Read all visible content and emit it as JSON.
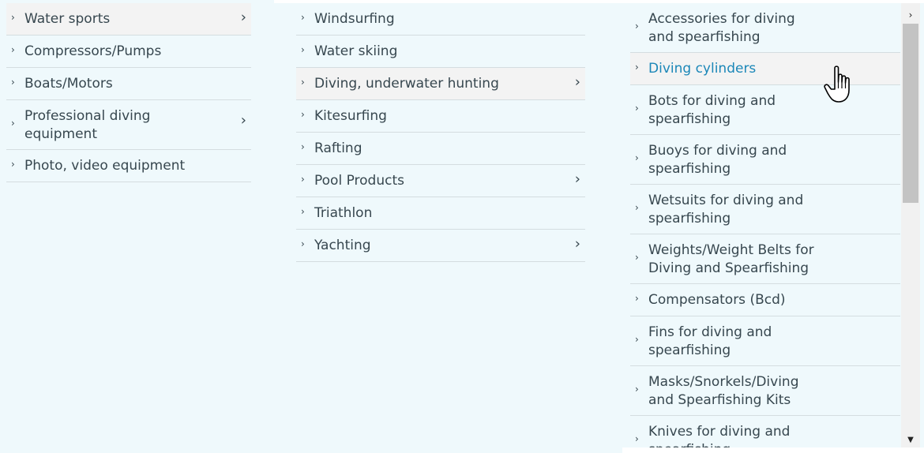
{
  "column1": {
    "items": [
      {
        "label": "Water sports",
        "has_children": true,
        "active": true
      },
      {
        "label": "Compressors/Pumps",
        "has_children": false
      },
      {
        "label": "Boats/Motors",
        "has_children": false
      },
      {
        "label": "Professional diving equipment",
        "has_children": true
      },
      {
        "label": "Photo, video equipment",
        "has_children": false
      }
    ]
  },
  "column2": {
    "items": [
      {
        "label": "Windsurfing",
        "has_children": false
      },
      {
        "label": "Water skiing",
        "has_children": false
      },
      {
        "label": "Diving, underwater hunting",
        "has_children": true,
        "active": true
      },
      {
        "label": "Kitesurfing",
        "has_children": false
      },
      {
        "label": "Rafting",
        "has_children": false
      },
      {
        "label": "Pool Products",
        "has_children": true
      },
      {
        "label": "Triathlon",
        "has_children": false
      },
      {
        "label": "Yachting",
        "has_children": true
      }
    ]
  },
  "column3": {
    "items": [
      {
        "label": "Accessories for diving and spearfishing"
      },
      {
        "label": "Diving cylinders",
        "hovered": true
      },
      {
        "label": "Bots for diving and spearfishing"
      },
      {
        "label": "Buoys for diving and spearfishing"
      },
      {
        "label": "Wetsuits for diving and spearfishing"
      },
      {
        "label": "Weights/Weight Belts for Diving and Spearfishing"
      },
      {
        "label": "Compensators (Bcd)"
      },
      {
        "label": "Fins for diving and spearfishing"
      },
      {
        "label": "Masks/Snorkels/Diving and Spearfishing Kits"
      },
      {
        "label": "Knives for diving and spearfishing"
      }
    ]
  },
  "icons": {
    "bullet": "chevron-right-small-icon",
    "expand": "chevron-right-icon",
    "scroll_up": "scroll-up-arrow-icon",
    "scroll_down": "scroll-down-arrow-icon",
    "pointer": "hand-pointer-icon"
  },
  "colors": {
    "panel_bg": "#eff9fc",
    "text": "#37474f",
    "hover_text": "#1b87b8",
    "active_bg": "#f3f3f3",
    "divider": "#d4dde0"
  }
}
